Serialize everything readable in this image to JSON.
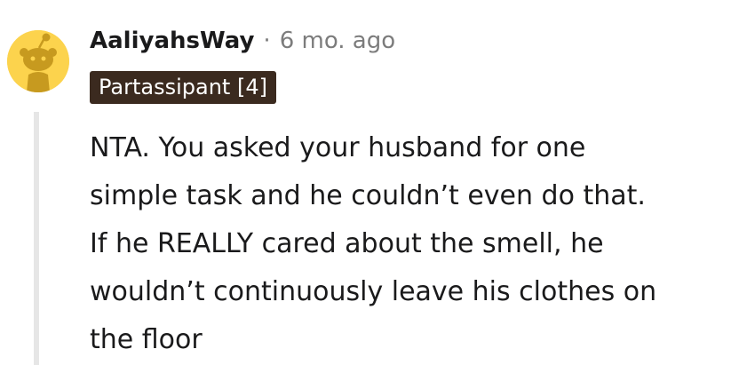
{
  "comment": {
    "username": "AaliyahsWay",
    "separator": "·",
    "timestamp": "6 mo. ago",
    "flair": "Partassipant [4]",
    "body": "NTA. You asked your husband for one\nsimple task and he couldn’t even do that.\nIf he REALLY cared about the smell, he\nwouldn’t continuously leave his clothes on\nthe floor"
  },
  "colors": {
    "avatar_background": "#fcd34d",
    "avatar_figure": "#c79a1f",
    "flair_background": "#3b2a1f",
    "flair_text": "#ffffff",
    "username": "#1a1a1b",
    "meta_text": "#7c7c7c",
    "thread_line": "#e6e6e6"
  },
  "icons": {
    "avatar": "snoo-avatar-icon"
  }
}
